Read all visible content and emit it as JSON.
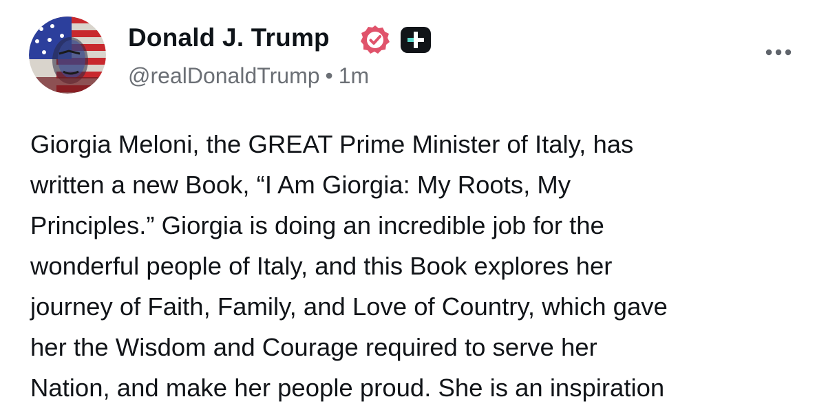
{
  "author": {
    "display_name": "Donald J. Trump",
    "handle": "@realDonaldTrump",
    "separator": "•",
    "timestamp": "1m",
    "avatar_icon": "flag-portrait-avatar",
    "verified_icon": "verified-badge-icon",
    "plus_icon": "plus-badge-icon"
  },
  "actions": {
    "more_icon": "more-options-icon"
  },
  "post": {
    "lines": [
      "Giorgia Meloni, the GREAT Prime Minister of Italy, has",
      "written a new Book, “I Am Giorgia: My Roots, My",
      "Principles.” Giorgia is doing an incredible job for the",
      "wonderful people of Italy, and this Book explores her",
      "journey of Faith, Family, and Love of Country, which gave",
      "her the Wisdom and Courage required to serve her",
      "Nation, and make her people proud. She is an inspiration"
    ]
  },
  "colors": {
    "verified": "#e0536b",
    "plus_badge": "#111418",
    "plus_accent": "#5cd6c9",
    "handle_text": "#6b6f75",
    "body_text": "#111418"
  }
}
